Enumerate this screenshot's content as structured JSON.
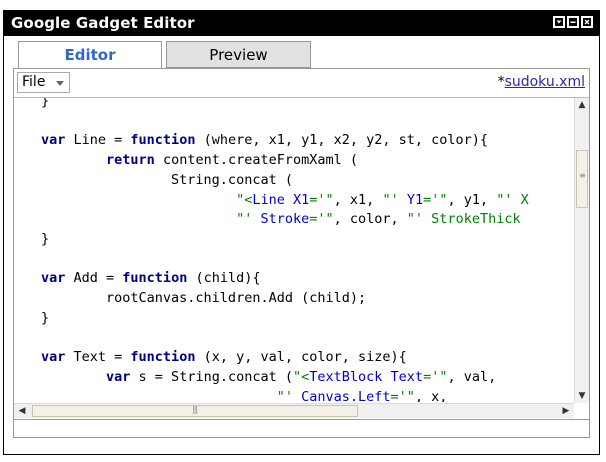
{
  "window": {
    "title": "Google Gadget Editor",
    "controls": [
      "dropdown-icon",
      "minimize-icon",
      "close-icon"
    ]
  },
  "tabs": [
    {
      "label": "Editor",
      "active": true
    },
    {
      "label": "Preview",
      "active": false
    }
  ],
  "toolbar": {
    "file_menu_label": "File",
    "modified_marker": "*",
    "filename": "sudoku.xml"
  },
  "code_lines": [
    "}",
    "",
    "var Line = function (where, x1, y1, x2, y2, st, color){",
    "        return content.createFromXaml (",
    "                String.concat (",
    "                        \"<Line X1='\", x1, \"' Y1='\", y1, \"' X",
    "                        \"' Stroke='\", color, \"' StrokeThick",
    "}",
    "",
    "var Add = function (child){",
    "        rootCanvas.children.Add (child);",
    "}",
    "",
    "var Text = function (x, y, val, color, size){",
    "        var s = String.concat (\"<TextBlock Text='\", val,",
    "                             \"' Canvas.Left='\", x,"
  ],
  "colors": {
    "titlebar": "#000000",
    "active_tab_text": "#3366cc",
    "keyword": "#000080",
    "string": "#008000"
  }
}
